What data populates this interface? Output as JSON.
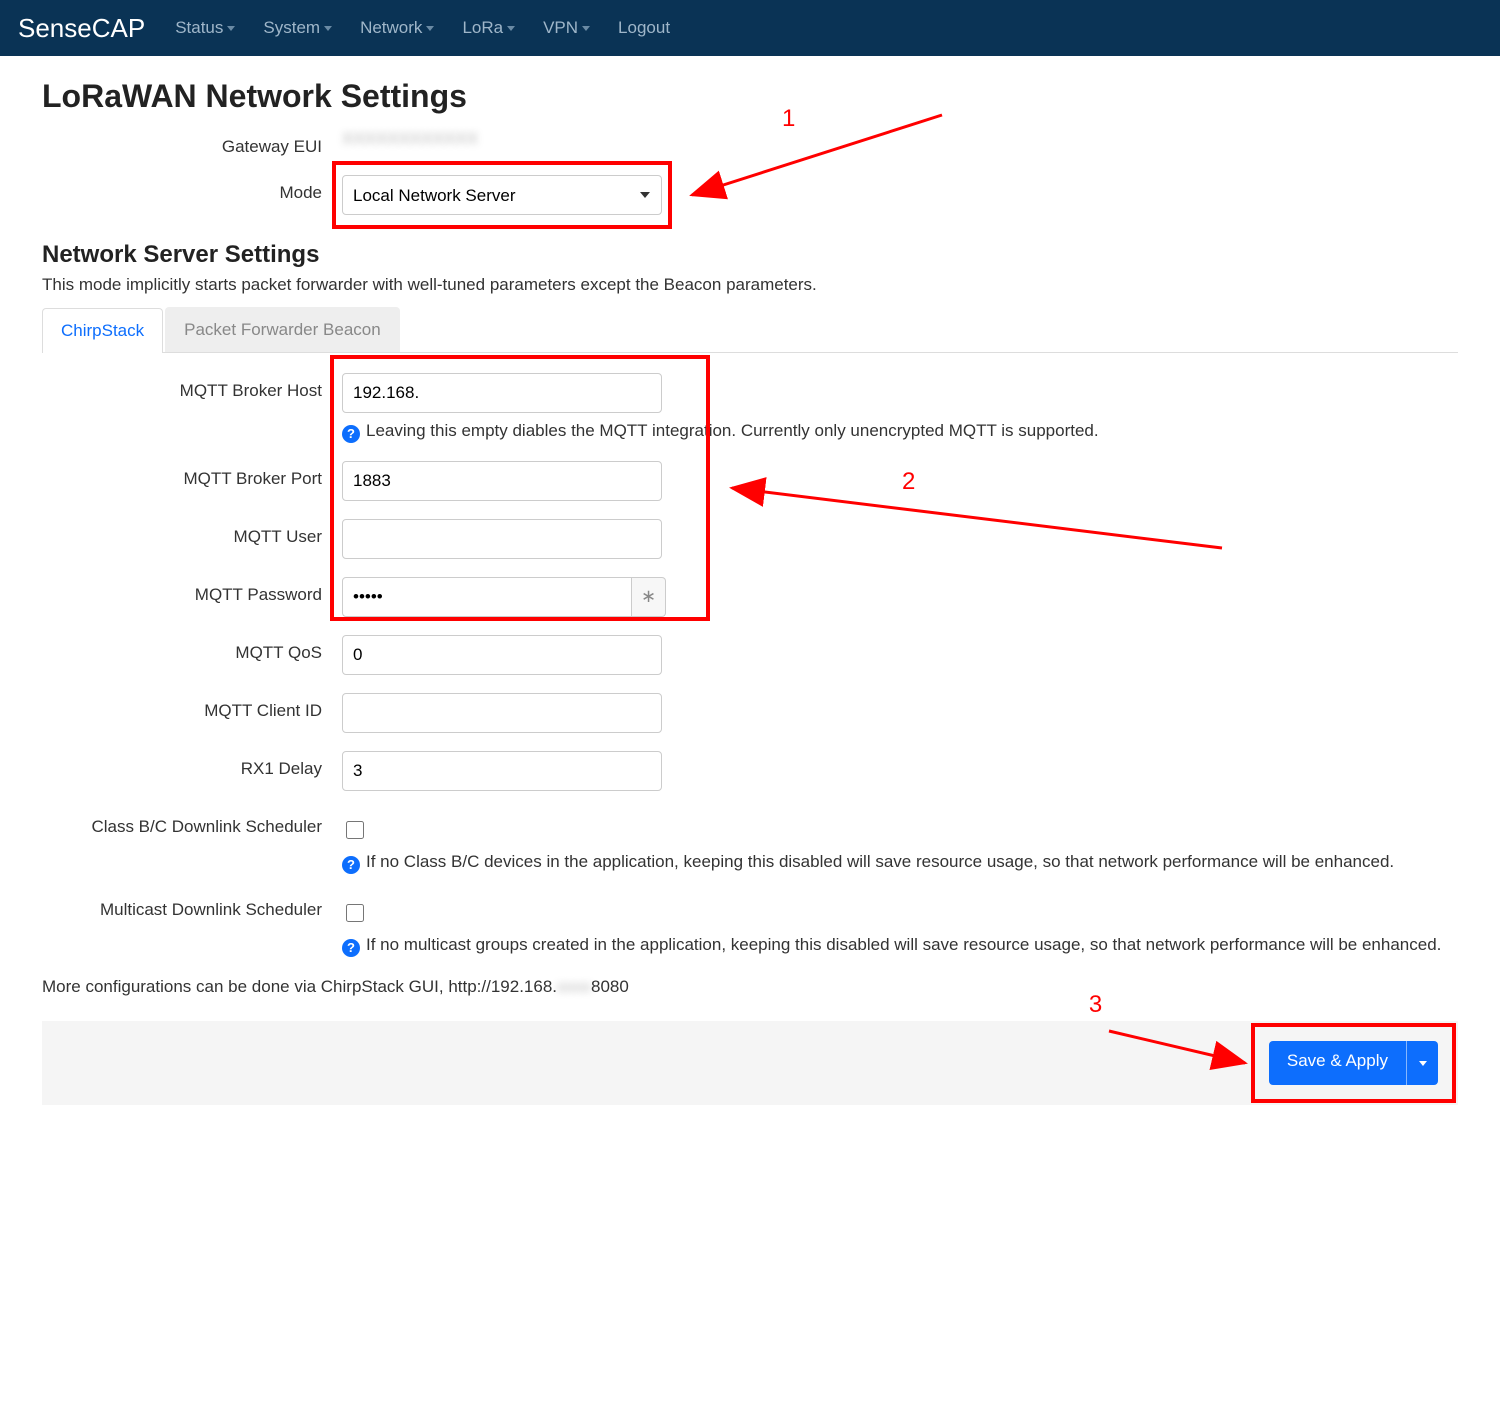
{
  "navbar": {
    "brand": "SenseCAP",
    "items": [
      "Status",
      "System",
      "Network",
      "LoRa",
      "VPN",
      "Logout"
    ],
    "dropdown_flags": [
      true,
      true,
      true,
      true,
      true,
      false
    ]
  },
  "page": {
    "title": "LoRaWAN Network Settings",
    "gateway_eui_label": "Gateway EUI",
    "gateway_eui_value": "XXXXXXXXXXXX",
    "mode_label": "Mode",
    "mode_value": "Local Network Server"
  },
  "section": {
    "title": "Network Server Settings",
    "description": "This mode implicitly starts packet forwarder with well-tuned parameters except the Beacon parameters."
  },
  "tabs": {
    "active": "ChirpStack",
    "inactive": "Packet Forwarder Beacon"
  },
  "form": {
    "mqtt_host_label": "MQTT Broker Host",
    "mqtt_host_value": "192.168.",
    "mqtt_host_hint": "Leaving this empty diables the MQTT integration. Currently only unencrypted MQTT is supported.",
    "mqtt_port_label": "MQTT Broker Port",
    "mqtt_port_value": "1883",
    "mqtt_user_label": "MQTT User",
    "mqtt_user_value": "",
    "mqtt_password_label": "MQTT Password",
    "mqtt_password_value": "•••••",
    "mqtt_qos_label": "MQTT QoS",
    "mqtt_qos_value": "0",
    "mqtt_client_id_label": "MQTT Client ID",
    "mqtt_client_id_value": "",
    "rx1_delay_label": "RX1 Delay",
    "rx1_delay_value": "3",
    "class_bc_label": "Class B/C Downlink Scheduler",
    "class_bc_hint": "If no Class B/C devices in the application, keeping this disabled will save resource usage, so that network performance will be enhanced.",
    "multicast_label": "Multicast Downlink Scheduler",
    "multicast_hint": "If no multicast groups created in the application, keeping this disabled will save resource usage, so that network performance will be enhanced."
  },
  "footer_note_prefix": "More configurations can be done via ChirpStack GUI, http://192.168.",
  "footer_note_suffix": "8080",
  "actions": {
    "save_apply": "Save & Apply"
  },
  "annotations": {
    "n1": "1",
    "n2": "2",
    "n3": "3"
  }
}
